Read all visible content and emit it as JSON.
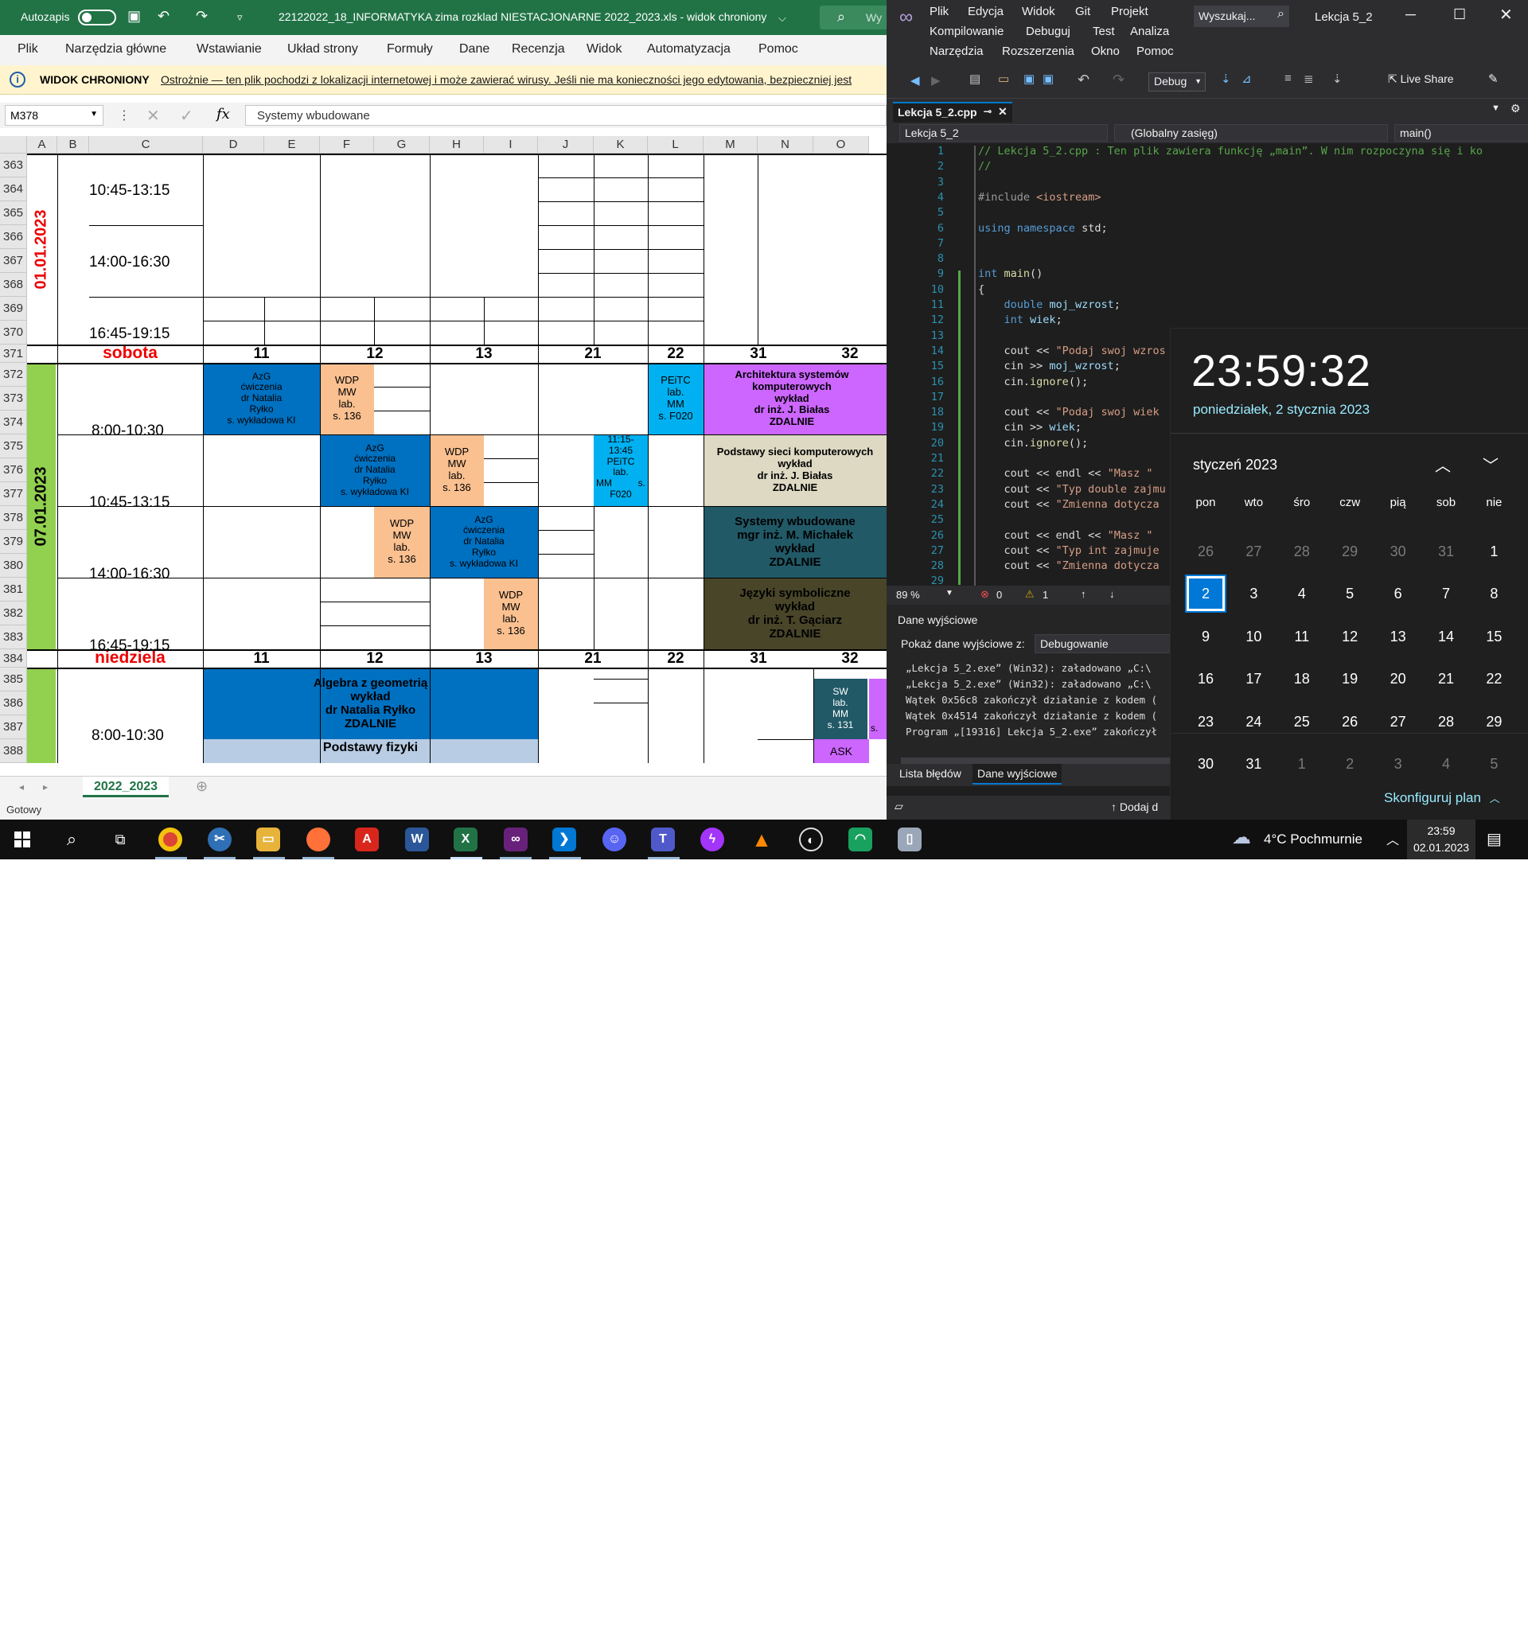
{
  "excel": {
    "autosave_label": "Autozapis",
    "file_title": "22122022_18_INFORMATYKA zima rozklad NIESTACJONARNE 2022_2023.xls  -  widok chroniony",
    "search_stub": "Wy",
    "menu": [
      "Plik",
      "Narzędzia główne",
      "Wstawianie",
      "Układ strony",
      "Formuły",
      "Dane",
      "Recenzja",
      "Widok",
      "Automatyzacja",
      "Pomoc"
    ],
    "protected_title": "WIDOK CHRONIONY",
    "protected_msg": "Ostrożnie — ten plik pochodzi z lokalizacji internetowej i może zawierać wirusy. Jeśli nie ma konieczności jego edytowania, bezpieczniej jest",
    "name_box": "M378",
    "formula": "Systemy wbudowane",
    "fx": "fx",
    "columns": [
      "A",
      "B",
      "C",
      "D",
      "E",
      "F",
      "G",
      "H",
      "I",
      "J",
      "K",
      "L",
      "M",
      "N",
      "O"
    ],
    "rows": [
      "363",
      "364",
      "365",
      "366",
      "367",
      "368",
      "369",
      "370",
      "371",
      "372",
      "373",
      "374",
      "375",
      "376",
      "377",
      "378",
      "379",
      "380",
      "381",
      "382",
      "383",
      "384",
      "385",
      "386",
      "387",
      "388"
    ],
    "date1": "01.01.2023",
    "date2": "07.01.2023",
    "times": {
      "t1": "10:45-13:15",
      "t2": "14:00-16:30",
      "t3": "16:45-19:15",
      "t4": "8:00-10:30",
      "t5": "10:45-13:15",
      "t6": "14:00-16:30",
      "t7": "16:45-19:15",
      "t8": "8:00-10:30"
    },
    "saturday": "sobota",
    "sunday": "niedziela",
    "groups": [
      "11",
      "12",
      "13",
      "21",
      "22",
      "31",
      "32"
    ],
    "cells": {
      "azg1": "AzG\nćwiczenia\ndr Natalia\nRyłko\ns. wykładowa KI",
      "wdp1": "WDP\nMW\nlab.\ns. 136",
      "peitc1": "PEiTC\nlab.\nMM\ns. F020",
      "ask1": "Architektura systemów komputerowych\nwykład\ndr inż. J. Białas\nZDALNIE",
      "azg2": "AzG\nćwiczenia\ndr Natalia\nRyłko\ns. wykładowa KI",
      "wdp2": "WDP\nMW\nlab.\ns. 136",
      "peitc2a": "11:15-\n13:45\nPEiTC\nlab.",
      "peitc2b_l": "MM",
      "peitc2b_r": "s.",
      "peitc2c": "F020",
      "psk": "Podstawy sieci komputerowych\nwykład\ndr inż. J. Białas\nZDALNIE",
      "wdp3": "WDP\nMW\nlab.\ns. 136",
      "azg3": "AzG\nćwiczenia\ndr Natalia\nRyłko\ns. wykładowa KI",
      "sw": "Systemy wbudowane\nmgr inż. M. Michałek\nwykład\nZDALNIE",
      "wdp4": "WDP\nMW\nlab.\ns. 136",
      "js": "Języki symboliczne\nwykład\ndr inż. T. Gąciarz\nZDALNIE",
      "alg": "Algebra z geometrią\nwykład\ndr Natalia Ryłko\nZDALNIE",
      "sw2": "SW\nlab.\nMM\ns. 131",
      "sw2b": "s.",
      "fiz": "Podstawy fizyki",
      "ask2": "ASK"
    },
    "sheet_tab": "2022_2023",
    "status": "Gotowy"
  },
  "vs": {
    "menu_row1": [
      "Plik",
      "Edycja",
      "Widok",
      "Git",
      "Projekt"
    ],
    "menu_row2": [
      "Kompilowanie",
      "Debuguj",
      "Test",
      "Analiza"
    ],
    "menu_row3": [
      "Narzędzia",
      "Rozszerzenia",
      "Okno",
      "Pomoc"
    ],
    "search_placeholder": "Wyszukaj...",
    "solution_name": "Lekcja 5_2",
    "config": "Debug",
    "live_share": "Live Share",
    "tab_file": "Lekcja 5_2.cpp",
    "nav_project": "Lekcja 5_2",
    "nav_scope": "(Globalny zasięg)",
    "nav_member": "main()",
    "zoom": "89 %",
    "errors": "0",
    "warnings": "1",
    "output_title": "Dane wyjściowe",
    "output_from_label": "Pokaż dane wyjściowe z:",
    "output_source": "Debugowanie",
    "output_lines": [
      "„Lekcja 5_2.exe” (Win32): załadowano „C:\\",
      "„Lekcja 5_2.exe” (Win32): załadowano „C:\\",
      "Wątek 0x56c8 zakończył działanie z kodem (",
      "Wątek 0x4514 zakończył działanie z kodem (",
      "Program „[19316] Lekcja 5_2.exe” zakończył"
    ],
    "bottom_tabs": [
      "Lista błędów",
      "Dane wyjściowe"
    ],
    "status_add": "Dodaj d"
  },
  "clock": {
    "time": "23:59:32",
    "date": "poniedziałek, 2 stycznia 2023",
    "month": "styczeń 2023",
    "weekdays": [
      "pon",
      "wto",
      "śro",
      "czw",
      "pią",
      "sob",
      "nie"
    ],
    "weeks": [
      [
        "26",
        "27",
        "28",
        "29",
        "30",
        "31",
        "1"
      ],
      [
        "2",
        "3",
        "4",
        "5",
        "6",
        "7",
        "8"
      ],
      [
        "9",
        "10",
        "11",
        "12",
        "13",
        "14",
        "15"
      ],
      [
        "16",
        "17",
        "18",
        "19",
        "20",
        "21",
        "22"
      ],
      [
        "23",
        "24",
        "25",
        "26",
        "27",
        "28",
        "29"
      ],
      [
        "30",
        "31",
        "1",
        "2",
        "3",
        "4",
        "5"
      ]
    ],
    "configure": "Skonfiguruj plan"
  },
  "taskbar": {
    "weather": "4°C  Pochmurnie",
    "time": "23:59",
    "date": "02.01.2023"
  },
  "colors": {
    "excel_green": "#217346",
    "blue_cell": "#0070c0",
    "orange_cell": "#fac090",
    "cyan_cell": "#00b0f0",
    "violet_cell": "#cc66ff",
    "beige_cell": "#ddd9c3",
    "teal_cell": "#215967",
    "olive_cell": "#494529",
    "light_green": "#92d050",
    "red_text": "#ff0000",
    "vs_purple": "#68217a",
    "calendar_accent": "#0078d7"
  }
}
